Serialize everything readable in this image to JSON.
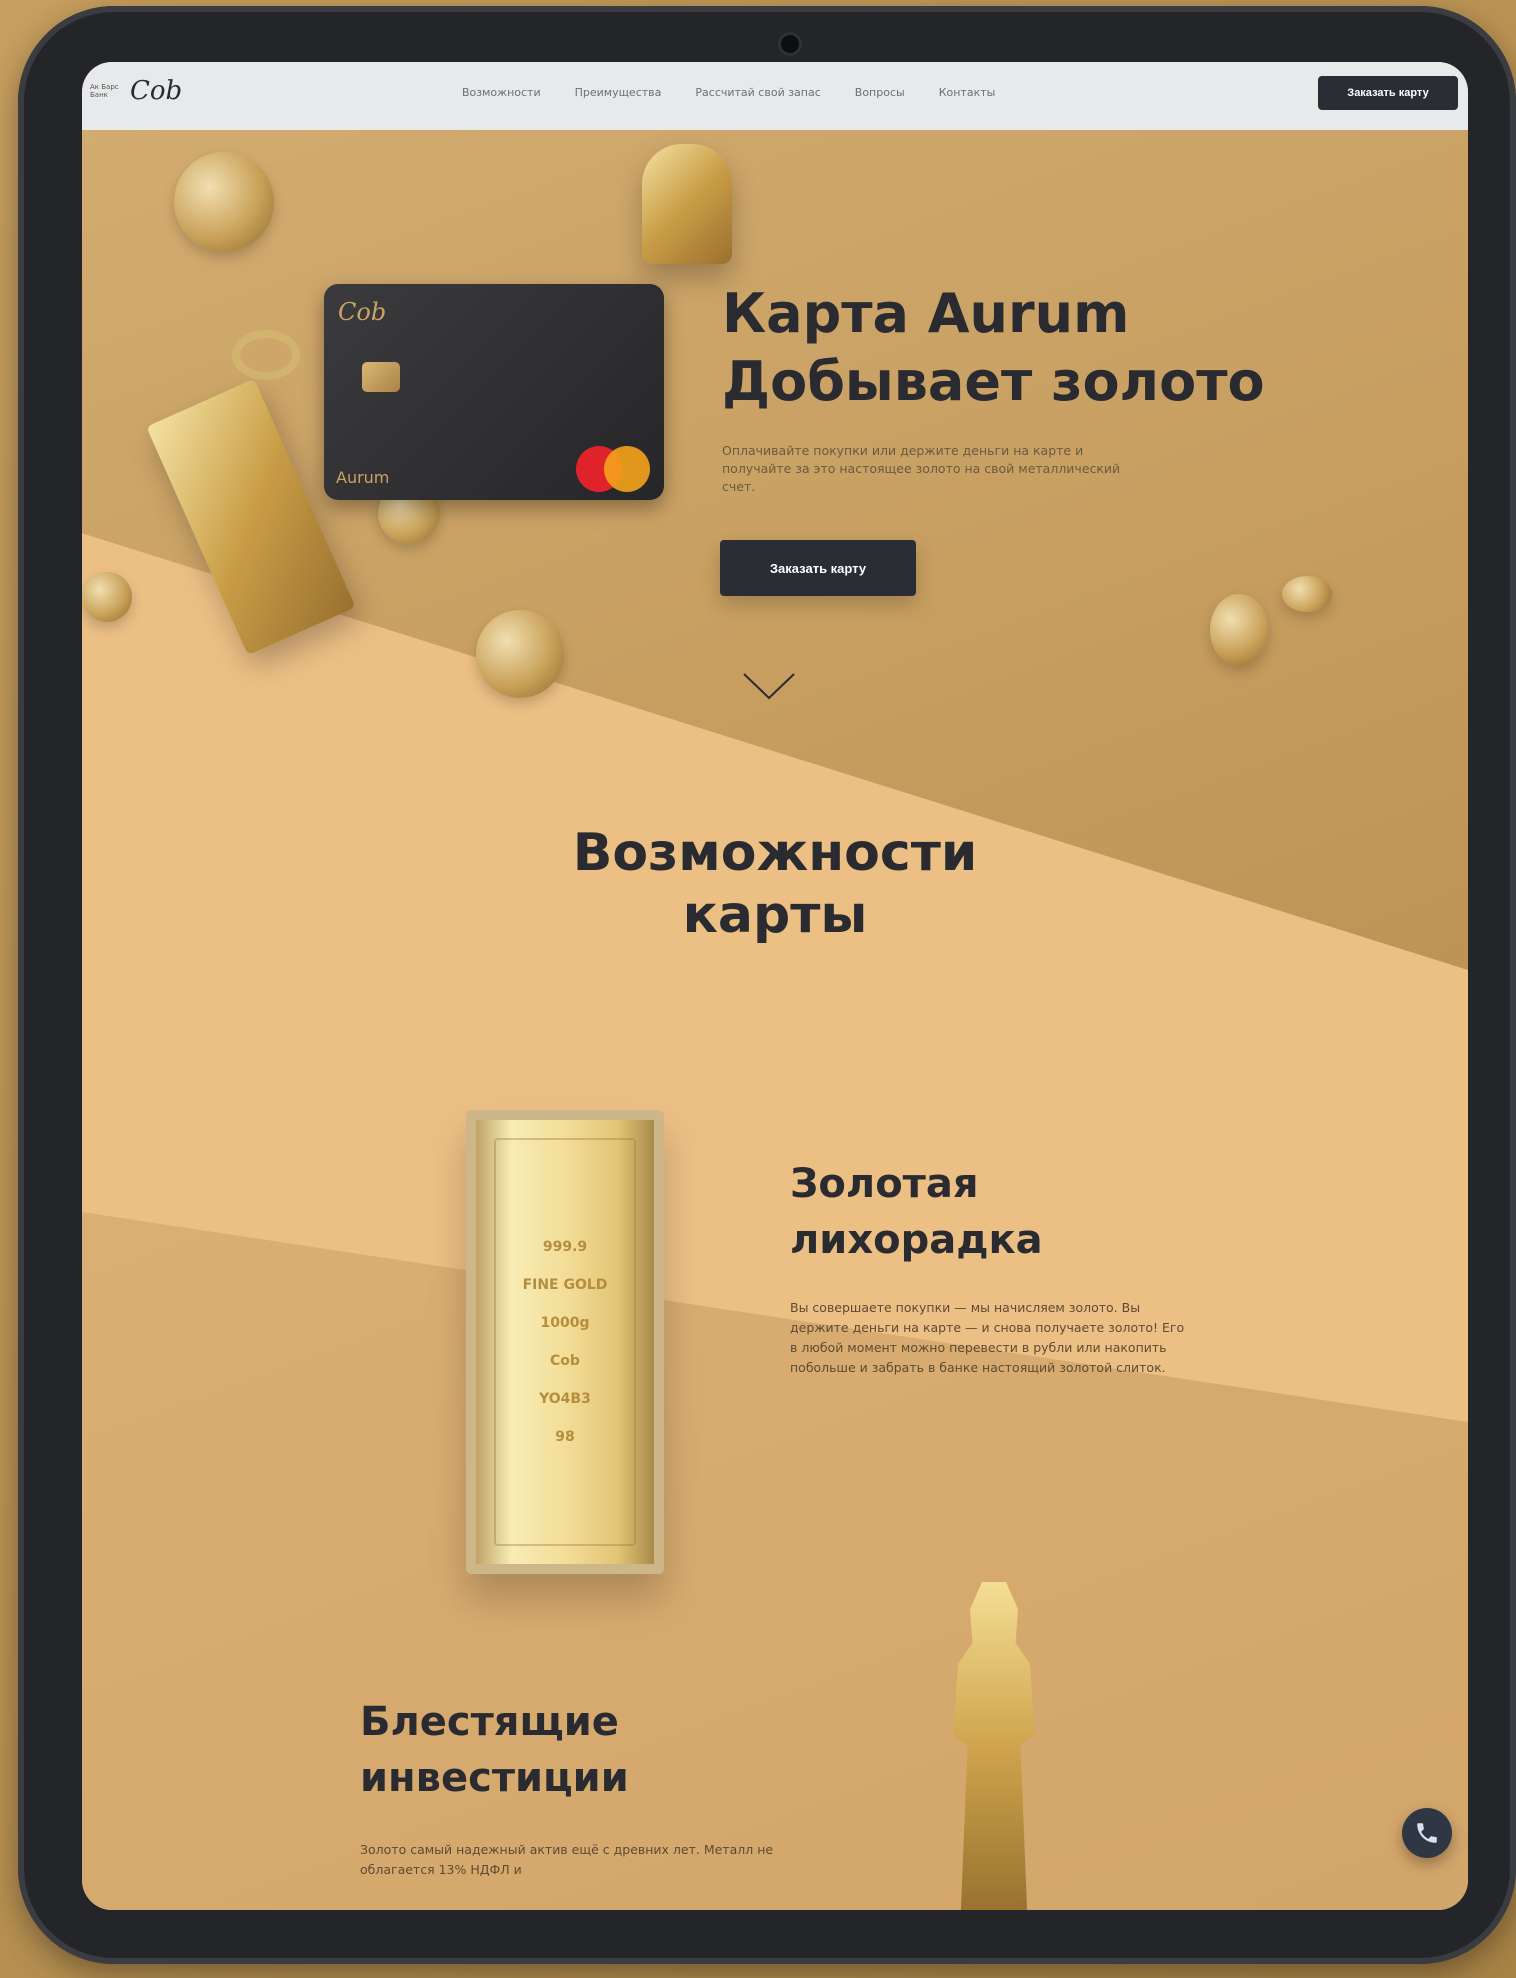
{
  "nav": {
    "logo_small": "Ак Барс Банк",
    "logo_mark": "Cob",
    "links": [
      "Возможности",
      "Преимущества",
      "Рассчитай свой запас",
      "Вопросы",
      "Контакты"
    ],
    "cta": "Заказать карту"
  },
  "hero": {
    "card_logo": "Cob",
    "card_name": "Aurum",
    "title": "Карта Aurum\nДобывает золото",
    "subtitle": "Оплачивайте покупки или держите деньги на карте и получайте за это настоящее золото на свой металлический счет.",
    "button": "Заказать карту"
  },
  "section": {
    "title": "Возможности\nкарты"
  },
  "feature1": {
    "bar_lines": [
      "999.9",
      "FINE GOLD",
      "1000g",
      "Cob",
      "YO4B3",
      "98"
    ],
    "title": "Золотая\nлихорадка",
    "text": "Вы совершаете покупки — мы начисляем золото. Вы держите деньги на карте — и снова получаете золото! Его в любой момент можно перевести в рубли или накопить побольше и забрать в банке настоящий золотой слиток."
  },
  "feature2": {
    "title": "Блестящие\nинвестиции",
    "text": "Золото самый надежный актив ещё с древних лет. Металл не облагается 13% НДФЛ и"
  },
  "colors": {
    "accent_dark": "#2a2d34",
    "page_bg": "#ecbf85",
    "gold": "#c9a364"
  },
  "icons": {
    "chevron": "chevron-down-icon",
    "fab": "phone-icon"
  }
}
